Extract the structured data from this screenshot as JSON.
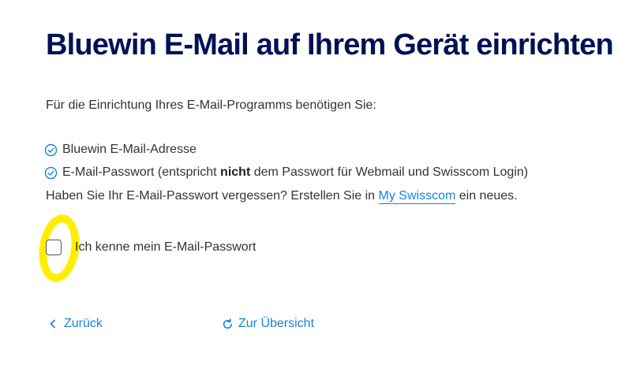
{
  "page": {
    "title": "Bluewin E-Mail auf Ihrem Gerät einrichten",
    "intro": "Für die Einrichtung Ihres E-Mail-Programms benötigen Sie:"
  },
  "requirements": [
    {
      "icon": "check-circle-icon",
      "text": "Bluewin E-Mail-Adresse"
    },
    {
      "icon": "check-circle-icon",
      "text_before": "E-Mail-Passwort (entspricht ",
      "bold": "nicht",
      "text_after": " dem Passwort für Webmail und Swisscom Login)"
    }
  ],
  "forgot": {
    "text_before": "Haben Sie Ihr E-Mail-Passwort vergessen? Erstellen Sie in ",
    "link_label": "My Swisscom",
    "text_after": " ein neues."
  },
  "checkbox": {
    "label": "Ich kenne mein E-Mail-Passwort",
    "checked": false
  },
  "navigation": {
    "back_label": "Zurück",
    "back_icon": "chevron-left-icon",
    "overview_label": "Zur Übersicht",
    "overview_icon": "refresh-icon"
  },
  "colors": {
    "title": "#001155",
    "text": "#333333",
    "link": "#1781e3",
    "highlight": "#ffee00"
  }
}
